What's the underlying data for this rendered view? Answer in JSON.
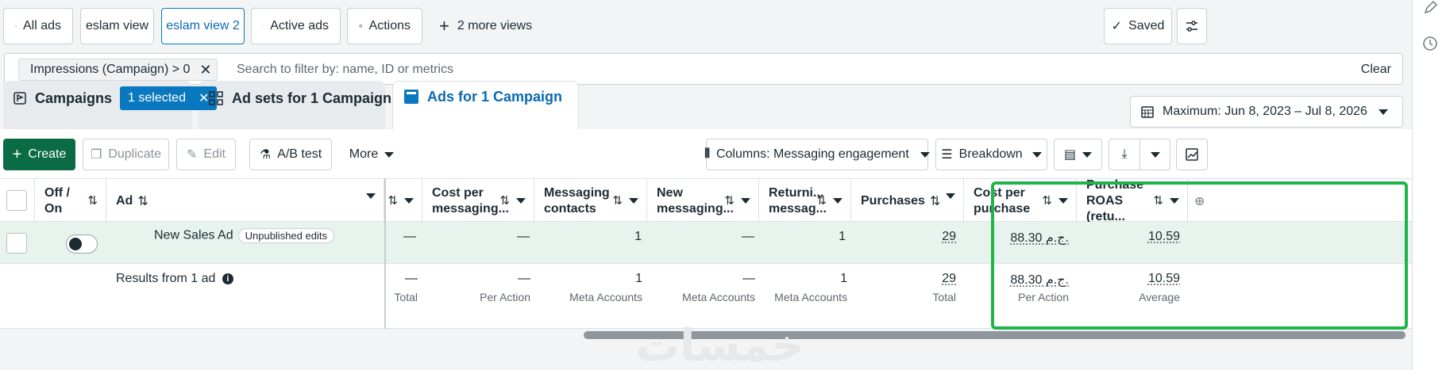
{
  "views": {
    "all_ads": "All ads",
    "eslam_view": "eslam view",
    "eslam_view_2": "eslam view 2",
    "active_ads": "Active ads",
    "actions": "Actions",
    "more_views": "2 more views",
    "saved": "Saved"
  },
  "filter": {
    "chip": "Impressions (Campaign) > 0",
    "placeholder": "Search to filter by: name, ID or metrics",
    "clear": "Clear"
  },
  "levels": {
    "campaigns": "Campaigns",
    "selected": "1 selected",
    "adsets": "Ad sets for 1 Campaign",
    "ads": "Ads for 1 Campaign"
  },
  "date_range": "Maximum: Jun 8, 2023 – Jul 8, 2026",
  "toolbar": {
    "create": "Create",
    "duplicate": "Duplicate",
    "edit": "Edit",
    "ab_test": "A/B test",
    "more": "More",
    "columns": "Columns: Messaging engagement",
    "breakdown": "Breakdown"
  },
  "table": {
    "headers": {
      "off_on": "Off / On",
      "ad": "Ad",
      "cost_per_messaging": "Cost per messaging...",
      "messaging_contacts": "Messaging contacts",
      "new_messaging": "New messaging...",
      "returning_messaging": "Returni... messag...",
      "purchases": "Purchases",
      "cost_per_purchase": "Cost per purchase",
      "purchase_roas": "Purchase ROAS (retu..."
    },
    "row": {
      "ad_name": "New Sales Ad",
      "badge": "Unpublished edits",
      "col0": "—",
      "cost_per_messaging": "—",
      "messaging_contacts": "1",
      "new_messaging": "—",
      "returning_messaging": "1",
      "purchases": "29",
      "cost_per_purchase": "88.30 ج.م.",
      "purchase_roas": "10.59"
    },
    "summary": {
      "label": "Results from 1 ad",
      "col0": "—",
      "col0_sub": "Total",
      "cost_per_messaging": "—",
      "cost_per_messaging_sub": "Per Action",
      "messaging_contacts": "1",
      "messaging_contacts_sub": "Meta Accounts",
      "new_messaging": "—",
      "new_messaging_sub": "Meta Accounts",
      "returning_messaging": "1",
      "returning_messaging_sub": "Meta Accounts",
      "purchases": "29",
      "purchases_sub": "Total",
      "cost_per_purchase": "88.30 ج.م.",
      "cost_per_purchase_sub": "Per Action",
      "purchase_roas": "10.59",
      "purchase_roas_sub": "Average"
    }
  },
  "watermark": "خمسات",
  "colors": {
    "accent": "#0a78be",
    "create": "#0b6b45",
    "row_highlight": "#e7f4ee",
    "frame": "#1fb54a"
  }
}
